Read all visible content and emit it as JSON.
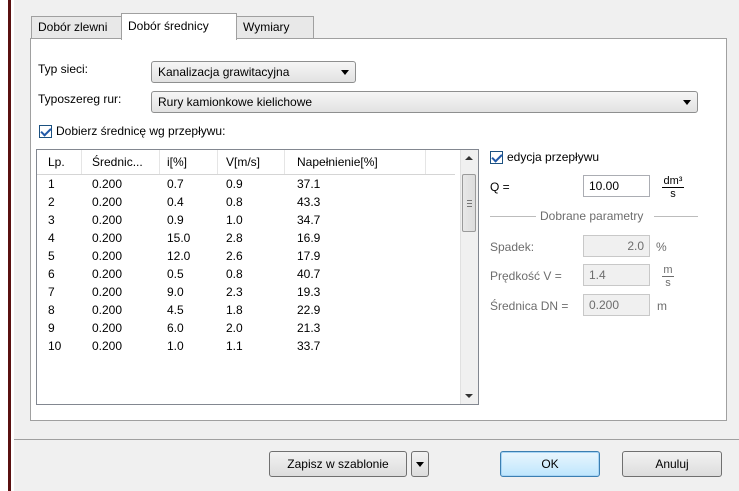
{
  "tabs": [
    {
      "label": "Dobór zlewni"
    },
    {
      "label": "Dobór średnicy"
    },
    {
      "label": "Wymiary"
    }
  ],
  "form": {
    "network_type_label": "Typ sieci:",
    "network_type_value": "Kanalizacja grawitacyjna",
    "pipe_series_label": "Typoszereg rur:",
    "pipe_series_value": "Rury kamionkowe kielichowe",
    "select_diameter_label": "Dobierz średnicę wg przepływu:",
    "select_diameter_checked": true
  },
  "table": {
    "columns": [
      "Lp.",
      "Średnic...",
      "i[%]",
      "V[m/s]",
      "Napełnienie[%]"
    ],
    "rows": [
      [
        "1",
        "0.200",
        "0.7",
        "0.9",
        "37.1"
      ],
      [
        "2",
        "0.200",
        "0.4",
        "0.8",
        "43.3"
      ],
      [
        "3",
        "0.200",
        "0.9",
        "1.0",
        "34.7"
      ],
      [
        "4",
        "0.200",
        "15.0",
        "2.8",
        "16.9"
      ],
      [
        "5",
        "0.200",
        "12.0",
        "2.6",
        "17.9"
      ],
      [
        "6",
        "0.200",
        "0.5",
        "0.8",
        "40.7"
      ],
      [
        "7",
        "0.200",
        "9.0",
        "2.3",
        "19.3"
      ],
      [
        "8",
        "0.200",
        "4.5",
        "1.8",
        "22.9"
      ],
      [
        "9",
        "0.200",
        "6.0",
        "2.0",
        "21.3"
      ],
      [
        "10",
        "0.200",
        "1.0",
        "1.1",
        "33.7"
      ]
    ]
  },
  "right": {
    "edit_flow_label": "edycja przepływu",
    "edit_flow_checked": true,
    "q_label": "Q =",
    "q_value": "10.00",
    "q_unit_num": "dm³",
    "q_unit_den": "s",
    "group_title": "Dobrane parametry",
    "slope_label": "Spadek:",
    "slope_value": "2.0",
    "slope_unit": "%",
    "speed_label": "Prędkość V =",
    "speed_value": "1.4",
    "speed_unit_num": "m",
    "speed_unit_den": "s",
    "diameter_label": "Średnica DN =",
    "diameter_value": "0.200",
    "diameter_unit": "m"
  },
  "buttons": {
    "save_template": "Zapisz w szablonie",
    "ok": "OK",
    "cancel": "Anuluj"
  }
}
